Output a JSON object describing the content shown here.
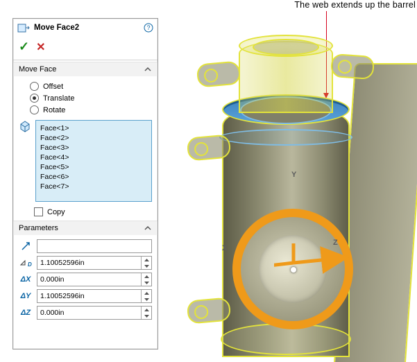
{
  "callout": "The web extends up the barrel",
  "feature": {
    "title": "Move Face2",
    "help_title": "Help"
  },
  "section_move_face": "Move Face",
  "mode": {
    "offset": "Offset",
    "translate": "Translate",
    "rotate": "Rotate",
    "selected": "translate"
  },
  "faces": [
    "Face<1>",
    "Face<2>",
    "Face<3>",
    "Face<4>",
    "Face<5>",
    "Face<6>",
    "Face<7>"
  ],
  "copy_label": "Copy",
  "section_params": "Parameters",
  "params": {
    "direction": "",
    "distance": "1.10052596in",
    "dx": "0.000in",
    "dy": "1.10052596in",
    "dz": "0.000in"
  },
  "labels": {
    "dx": "ΔX",
    "dy": "ΔY",
    "dz": "ΔZ"
  },
  "axis": {
    "x": "X",
    "y": "Y",
    "z": "Z"
  }
}
